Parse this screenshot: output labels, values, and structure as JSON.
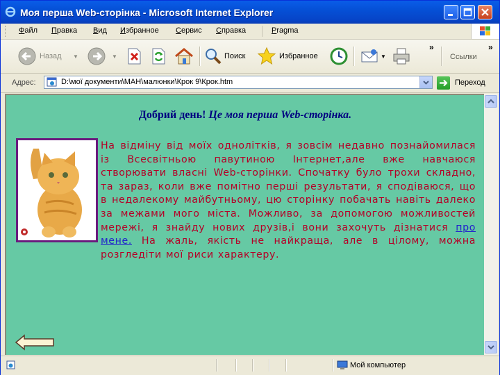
{
  "window": {
    "title": "Моя перша Web-сторінка - Microsoft Internet Explorer"
  },
  "menu": {
    "items": [
      {
        "label": "Файл",
        "acc": "Ф",
        "rest": "айл"
      },
      {
        "label": "Правка",
        "acc": "П",
        "rest": "равка"
      },
      {
        "label": "Вид",
        "acc": "В",
        "rest": "ид"
      },
      {
        "label": "Избранное",
        "acc": "И",
        "rest": "збранное"
      },
      {
        "label": "Сервис",
        "acc": "С",
        "rest": "ервис"
      },
      {
        "label": "Справка",
        "acc": "С",
        "rest": "правка"
      },
      {
        "label": "Pragma",
        "acc": "P",
        "rest": "ragma"
      }
    ]
  },
  "toolbar": {
    "back_label": "Назад",
    "search_label": "Поиск",
    "favorites_label": "Избранное",
    "links_label": "Ссылки",
    "overflow": "»"
  },
  "address": {
    "label": "Адрес:",
    "value": "D:\\мої документи\\МАН\\малюнки\\Крок 9\\Крок.htm",
    "go_label": "Переход"
  },
  "page": {
    "heading_plain": "Добрий день! ",
    "heading_italic": "Це моя перша Web-сторінка.",
    "paragraph_before_link": "На відміну від моїх однолітків, я зовсім недавно познайомилася із Всесвітньою павутиною Інтернет,але вже навчаюся створювати власні Web-сторінки. Спочатку було трохи складно, та зараз, коли вже помітно перші результати, я сподіваюся, що в недалекому майбутньому, цю сторінку побачать навіть далеко за межами мого міста. Можливо, за допомогою можливостей мережі, я знайду нових друзів,і вони захочуть дізнатися ",
    "link_text": "про мене.",
    "paragraph_after_link": " На жаль, якість не найкраща, але в цілому, можна розгледіти мої риси характеру."
  },
  "status": {
    "zone": "Мой компьютер"
  },
  "colors": {
    "content_bg": "#66c9a4",
    "body_text": "#b40027",
    "heading": "#000080",
    "link": "#2222cc",
    "frame": "#6a1b7e"
  }
}
